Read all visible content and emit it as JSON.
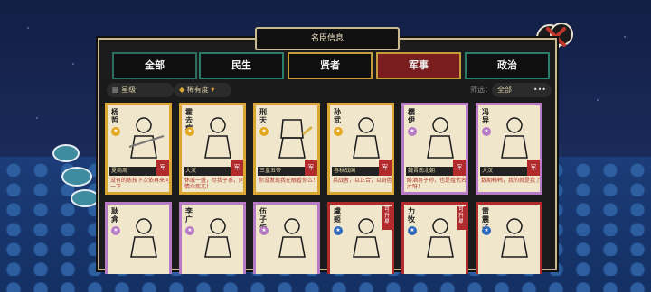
{
  "title_bar": {
    "label": "名臣信息"
  },
  "tabs": [
    {
      "label": "全部",
      "state": "normal"
    },
    {
      "label": "民生",
      "state": "normal"
    },
    {
      "label": "贤者",
      "state": "gold"
    },
    {
      "label": "军事",
      "state": "active"
    },
    {
      "label": "政治",
      "state": "normal"
    }
  ],
  "filter": {
    "star_level_label": "星级",
    "rarity_label": "稀有度",
    "filter_label": "筛选：",
    "filter_value": "全部",
    "more_icon": "ellipsis-icon"
  },
  "close_button_icon": "close-icon",
  "cards_row1": [
    {
      "name": "杨哲",
      "rank": "gold",
      "badge": "军",
      "sub": "夏商周",
      "desc": "没有的练技下次依再来问一下"
    },
    {
      "name": "霍去病",
      "rank": "gold",
      "badge": "军",
      "sub": "大汉",
      "desc": "休戚一盛，尽我子系，同情众疾兀！"
    },
    {
      "name": "刑天",
      "rank": "gold",
      "badge": "军",
      "sub": "三皇五帝",
      "desc": "你没发现我在眼看你么！"
    },
    {
      "name": "孙武",
      "rank": "gold",
      "badge": "军",
      "sub": "春秋战国",
      "desc": "兵战者，以正合，以奇胜"
    },
    {
      "name": "樱伊",
      "rank": "purple",
      "badge": "军",
      "sub": "魏晋南北朝",
      "desc": "醉酒男子孙，也是煌代名才呀！"
    },
    {
      "name": "冯异",
      "rank": "purple",
      "badge": "军",
      "sub": "大汉",
      "desc": "数期韩韩，我的就是我了"
    }
  ],
  "cards_row2": [
    {
      "name": "耿弇",
      "rank": "purple",
      "border": "purple"
    },
    {
      "name": "李广",
      "rank": "purple",
      "border": "purple"
    },
    {
      "name": "伍子胥",
      "rank": "purple",
      "border": "purple"
    },
    {
      "name": "虞姬",
      "rank": "blue",
      "border": "red",
      "tag": "可升星"
    },
    {
      "name": "力牧",
      "rank": "blue",
      "border": "red",
      "tag": "可升星"
    },
    {
      "name": "雷震子",
      "rank": "blue",
      "border": "red"
    }
  ]
}
